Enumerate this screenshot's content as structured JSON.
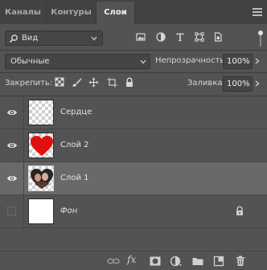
{
  "tabs": [
    {
      "label": "Каналы",
      "active": false
    },
    {
      "label": "Контуры",
      "active": false
    },
    {
      "label": "Слои",
      "active": true
    }
  ],
  "filter": {
    "kind_label": "Вид",
    "icons": [
      "pixel-filter-icon",
      "adjustment-filter-icon",
      "type-filter-icon",
      "shape-filter-icon",
      "smart-object-filter-icon"
    ]
  },
  "blend": {
    "mode_label": "Обычные",
    "opacity_label": "Непрозрачность:",
    "opacity_value": "100%"
  },
  "lock": {
    "label": "Закрепить:",
    "icons": [
      "lock-transparent-pixels-icon",
      "lock-image-pixels-icon",
      "lock-position-icon",
      "lock-artboard-icon",
      "lock-all-icon"
    ],
    "fill_label": "Заливка:",
    "fill_value": "100%"
  },
  "layers": [
    {
      "name": "Сердце",
      "visible": true,
      "selected": false,
      "thumbnail": "transparent",
      "locked": false
    },
    {
      "name": "Слой 2",
      "visible": true,
      "selected": false,
      "thumbnail": "red-heart",
      "locked": false
    },
    {
      "name": "Слой 1",
      "visible": true,
      "selected": true,
      "thumbnail": "photo-heart",
      "locked": false
    },
    {
      "name": "Фон",
      "visible": false,
      "selected": false,
      "thumbnail": "white",
      "locked": true
    }
  ],
  "bottom_bar": {
    "fx_label": "fx",
    "icons": [
      "link-layers-icon",
      "add-style-icon",
      "add-mask-icon",
      "adjustment-layer-icon",
      "new-group-icon",
      "new-layer-icon",
      "delete-layer-icon"
    ]
  },
  "colors": {
    "panel_bg": "#535353",
    "tabbar_bg": "#424242",
    "selected_row": "#696969",
    "heart_red": "#e01010"
  }
}
